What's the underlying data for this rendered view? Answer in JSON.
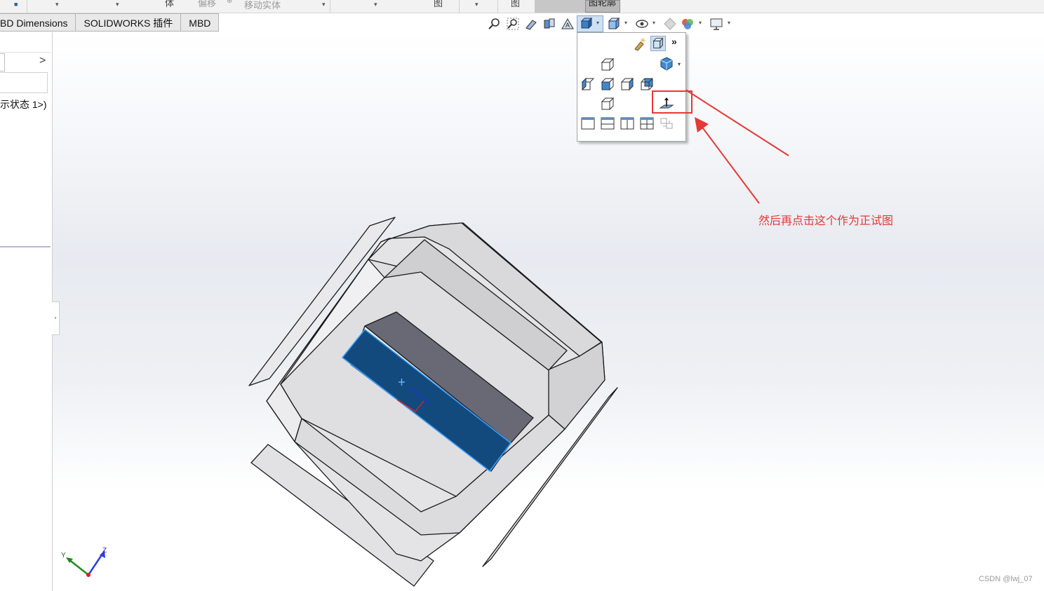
{
  "ribbon": {
    "item_body": "体",
    "item_offset": "偏移",
    "item_move": "移动实体",
    "item_view": "图",
    "item_outline": "图轮廓"
  },
  "tabs": [
    {
      "label": "BD Dimensions"
    },
    {
      "label": "SOLIDWORKS 插件"
    },
    {
      "label": "MBD"
    }
  ],
  "left_panel": {
    "chevron": ">",
    "config_text": "示状态 1>)"
  },
  "heads_up_toolbar": {
    "icons": [
      "zoom-to-fit-icon",
      "zoom-to-area-icon",
      "previous-view-icon",
      "section-view-icon",
      "dynamic-annotation-icon",
      "view-orientation-icon",
      "display-style-icon",
      "hide-show-items-icon",
      "edit-appearance-icon",
      "apply-scene-icon",
      "view-settings-icon"
    ]
  },
  "view_orientation_flyout": {
    "more": "»",
    "icons": [
      "new-view-icon",
      "view-selector-icon",
      "top-view-icon",
      "isometric-view-icon",
      "left-view-icon",
      "front-view-icon",
      "right-view-icon",
      "back-view-icon",
      "bottom-view-icon",
      "normal-to-icon",
      "single-view-icon",
      "two-view-horizontal-icon",
      "two-view-vertical-icon",
      "four-view-icon",
      "link-views-icon"
    ]
  },
  "annotation": {
    "text": "然后再点击这个作为正试图"
  },
  "triad": {
    "y_label": "Y",
    "z_label": "Z"
  },
  "watermark": "CSDN @lwj_07",
  "colors": {
    "selected_face": "#134a7e",
    "annotation_red": "#e53935",
    "toolbar_highlight": "#cfe0f3"
  }
}
